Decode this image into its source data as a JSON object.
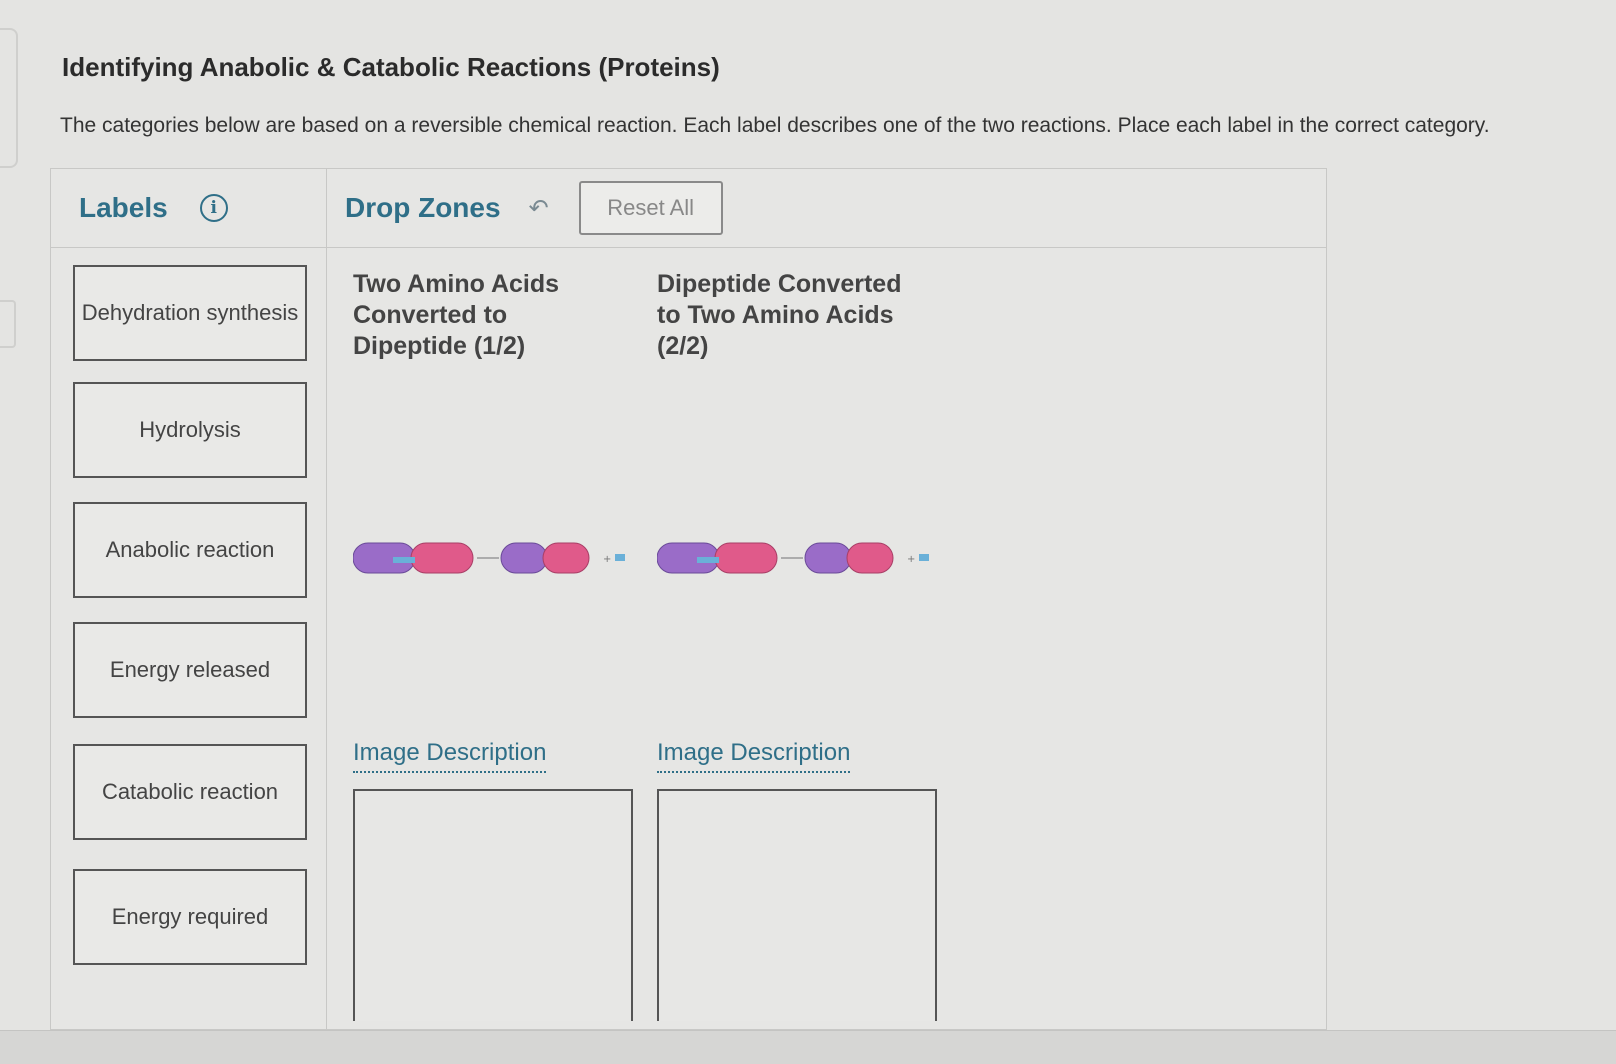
{
  "title": "Identifying Anabolic & Catabolic Reactions (Proteins)",
  "instructions": "The categories below are based on a reversible chemical reaction.  Each label describes one of the two reactions. Place each label in the correct category.",
  "labels_panel": {
    "title": "Labels",
    "info_icon": "info-icon",
    "items": [
      {
        "label": "Dehydration synthesis"
      },
      {
        "label": "Hydrolysis"
      },
      {
        "label": "Anabolic reaction"
      },
      {
        "label": "Energy released"
      },
      {
        "label": "Catabolic reaction"
      },
      {
        "label": "Energy required"
      }
    ]
  },
  "drop_zones_panel": {
    "title": "Drop Zones",
    "undo_icon": "undo-icon",
    "reset_label": "Reset All",
    "zones": [
      {
        "title": "Two Amino Acids Converted to Dipeptide (1/2)",
        "image_description": "Image Description"
      },
      {
        "title": "Dipeptide Converted to Two Amino Acids (2/2)",
        "image_description": "Image Description"
      }
    ]
  },
  "colors": {
    "accent": "#2f6f88",
    "purple_amino": "#9a6cc8",
    "pink_amino": "#e05a8a",
    "water_blue": "#6ab0d8"
  }
}
